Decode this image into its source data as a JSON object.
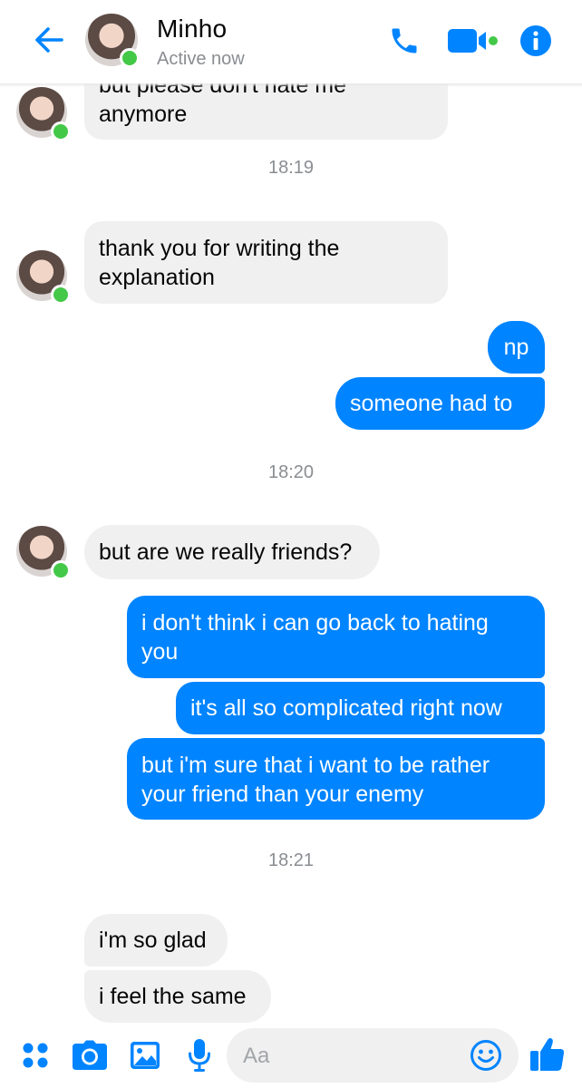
{
  "header": {
    "contact_name": "Minho",
    "status": "Active now"
  },
  "colors": {
    "messenger_blue": "#0084ff",
    "incoming_bubble": "#f0f0f0",
    "online_green": "#44c848",
    "meta_gray": "#8a8d91"
  },
  "icons": {
    "back": "back-arrow-icon",
    "call": "phone-icon",
    "video": "video-camera-icon",
    "info": "info-icon",
    "more": "four-dots-icon",
    "camera": "camera-icon",
    "gallery": "image-icon",
    "mic": "microphone-icon",
    "emoji": "smiley-icon",
    "like": "thumbs-up-icon"
  },
  "messages": {
    "m0": {
      "sender": "Minho",
      "lines": [
        "but please don't hate me",
        "anymore"
      ]
    },
    "t1": "18:19",
    "m1": {
      "sender": "Minho",
      "lines": [
        "thank you for writing the",
        "explanation"
      ]
    },
    "m2": {
      "sender": "me",
      "lines": [
        "np"
      ]
    },
    "m3": {
      "sender": "me",
      "lines": [
        "someone had to"
      ]
    },
    "t2": "18:20",
    "m4": {
      "sender": "Minho",
      "lines": [
        "but are we really friends?"
      ]
    },
    "m5": {
      "sender": "me",
      "lines": [
        "i don't think i can go back to hating",
        "you"
      ]
    },
    "m6": {
      "sender": "me",
      "lines": [
        "it's all so complicated right now"
      ]
    },
    "m7": {
      "sender": "me",
      "lines": [
        "but i'm sure that i want to be rather",
        "your friend than your enemy"
      ]
    },
    "t3": "18:21",
    "m8": {
      "sender": "Minho",
      "lines": [
        "i'm so glad"
      ]
    },
    "m9": {
      "sender": "Minho",
      "lines": [
        "i feel the same"
      ]
    }
  },
  "composer": {
    "placeholder": "Aa"
  }
}
